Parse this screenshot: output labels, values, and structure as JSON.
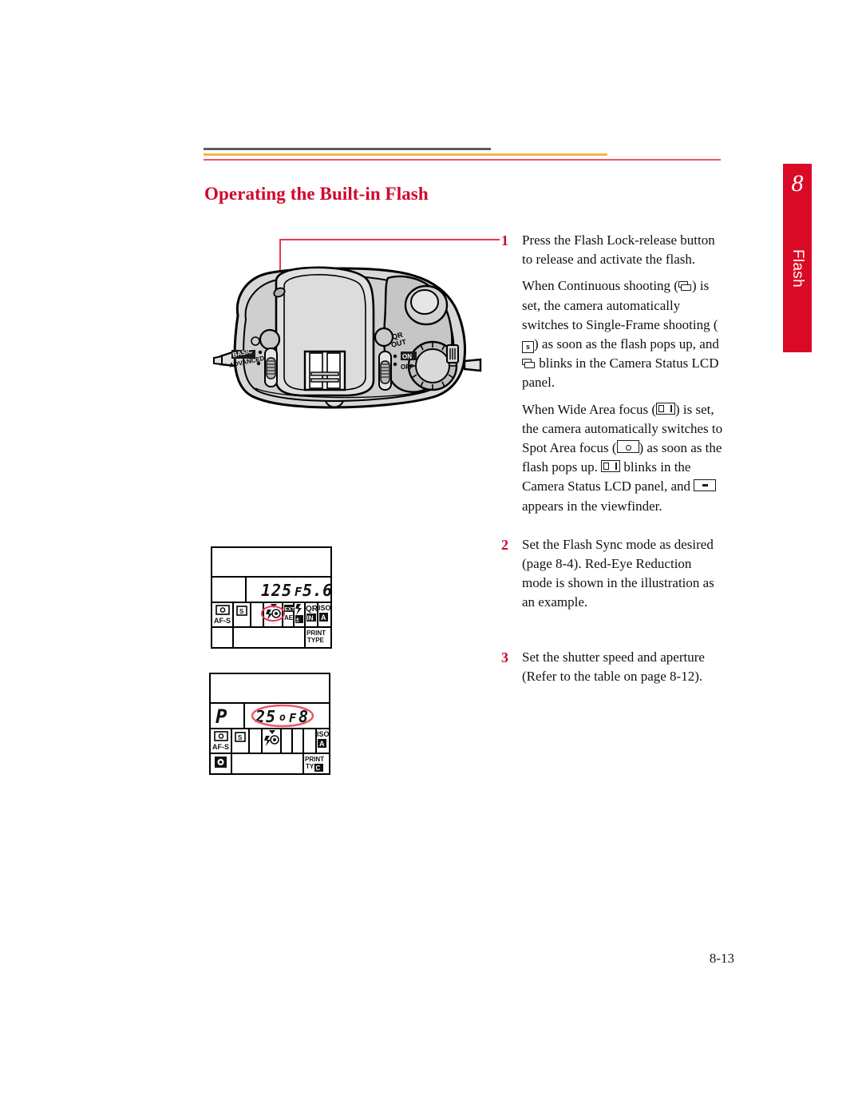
{
  "page": {
    "heading": "Operating the Built-in Flash",
    "page_number": "8-13",
    "colors": {
      "heading_red": "#d1062c",
      "tab_red": "#da0a26",
      "rule_dark": "#5c5c5c",
      "rule_orange": "#f7b34c",
      "rule_red": "#ef5565",
      "callout_red": "#e8384f"
    }
  },
  "chapter_tab": {
    "number": "8",
    "label": "Flash"
  },
  "steps": [
    {
      "number": "1",
      "paragraphs": [
        "Press the Flash Lock-release button to release and activate the flash.",
        "When Continuous shooting ( ) is set, the camera automatically switches to Single-Frame shooting ( ) as soon as the flash pops up, and   blinks in the Camera Status LCD panel.",
        "When Wide Area focus ( ) is set, the camera automatically switches to Spot Area focus ( ) as soon as the flash pops up.   blinks in the Camera Status LCD panel, and   appears in the viewfinder."
      ],
      "p1_part1": "Press the Flash Lock-release button to release and activate the flash.",
      "p2_a": "When Continuous shooting (",
      "p2_b": ") is set, the camera automatically switches to Single-Frame shooting (",
      "p2_single_label": "s",
      "p2_c": ") as soon as the flash pops up, and",
      "p2_d": "blinks in the Camera Status LCD panel.",
      "p3_a": "When Wide Area focus (",
      "p3_b": ") is set, the camera automatically switches to Spot Area focus (",
      "p3_c": ") as soon as the flash pops up.",
      "p3_d": "blinks in the Camera Status LCD panel, and",
      "p3_e": "appears in the viewfinder."
    },
    {
      "number": "2",
      "paragraphs": [
        "Set the Flash Sync mode as desired (page 8-4). Red-Eye Reduction mode is shown in the illustration as an example."
      ],
      "text": "Set the Flash Sync mode as desired (page 8-4). Red-Eye Reduction mode is shown in the illustration as an example."
    },
    {
      "number": "3",
      "paragraphs": [
        "Set the shutter speed and aperture (Refer to the table on page 8-12)."
      ],
      "text": "Set the shutter speed and aperture (Refer to the table on page 8-12)."
    }
  ],
  "camera_illustration": {
    "caption": "camera top view",
    "labels": {
      "mode_basic": "BASIC",
      "mode_advanced": "ADVANCED",
      "qr_up": "QR",
      "qr_out": "OUT",
      "power_on": "ON",
      "power_off": "OFF"
    }
  },
  "lcd_panels": [
    {
      "name": "camera-status-lcd-step2",
      "main_display": "125",
      "aperture_prefix": "F",
      "aperture": "5.6",
      "mode": "",
      "focus_mode": "AF-S",
      "focus_icon": "spot-focus-icon",
      "drive_mode": "S",
      "flash_sync_icon": "red-eye-reduction-icon",
      "flash_sync_highlighted": true,
      "metering": "EXT AE",
      "exposure_comp_icon": "flash-exposure-compensation-icon",
      "quick_return": "QR IN",
      "iso_label": "ISO",
      "iso_value": "A",
      "print_type": "PRINT TYPE",
      "print_code": ""
    },
    {
      "name": "camera-status-lcd-step3",
      "exposure_mode": "P",
      "main_display": "25",
      "main_suffix": "o",
      "aperture_prefix": "F",
      "aperture": "8",
      "value_highlighted": true,
      "focus_mode": "AF-S",
      "focus_icon": "spot-focus-icon",
      "drive_mode": "S",
      "flash_sync_icon": "red-eye-reduction-icon",
      "iso_label": "ISO",
      "iso_value": "A",
      "print_type": "PRINT TYPE",
      "print_code": "C",
      "bottom_left_icon": "spot-metering-icon"
    }
  ]
}
